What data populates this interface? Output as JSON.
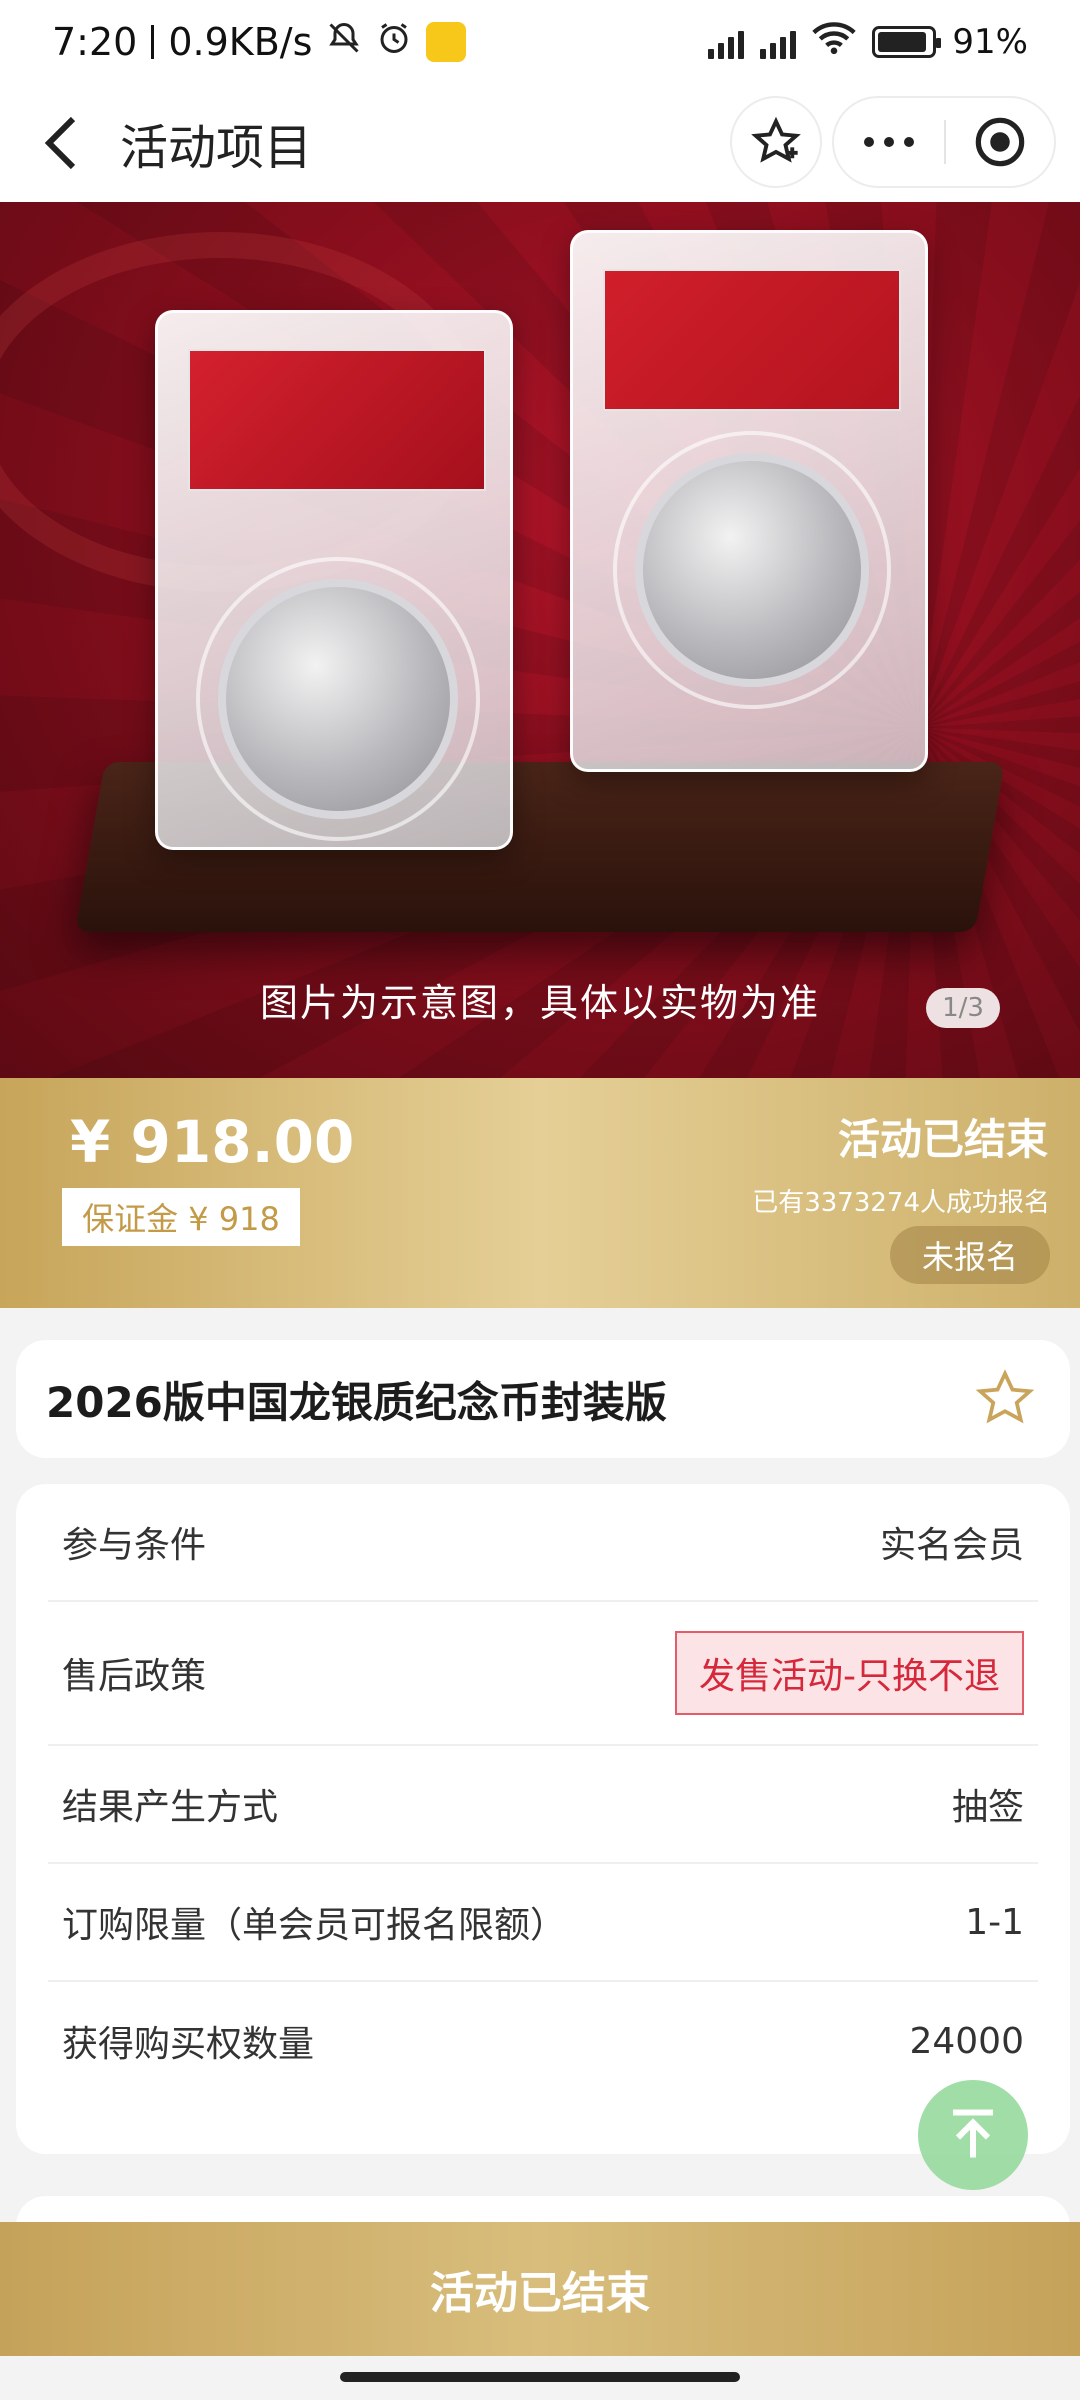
{
  "status_bar": {
    "time": "7:20",
    "speed": "0.9KB/s",
    "battery": "91%",
    "battery_level": 0.91
  },
  "header": {
    "title": "活动项目"
  },
  "hero": {
    "caption": "图片为示意图，具体以实物为准",
    "pager": "1/3"
  },
  "price_band": {
    "price": "¥ 918.00",
    "deposit": "保证金 ¥ 918",
    "activity_status": "活动已结束",
    "signed_count": "已有3373274人成功报名",
    "user_status": "未报名"
  },
  "product": {
    "name": "2026版中国龙银质纪念币封装版"
  },
  "details": [
    {
      "key": "参与条件",
      "value": "实名会员"
    },
    {
      "key": "售后政策",
      "value": "发售活动-只换不退"
    },
    {
      "key": "结果产生方式",
      "value": "抽签"
    },
    {
      "key": "订购限量（单会员可报名限额）",
      "value": "1-1"
    },
    {
      "key": "获得购买权数量",
      "value": "24000"
    }
  ],
  "bottom": {
    "button": "活动已结束"
  },
  "colors": {
    "gold": "#c7a55a",
    "policy_red": "#d6283b",
    "hero_red": "#8a0e1d"
  }
}
